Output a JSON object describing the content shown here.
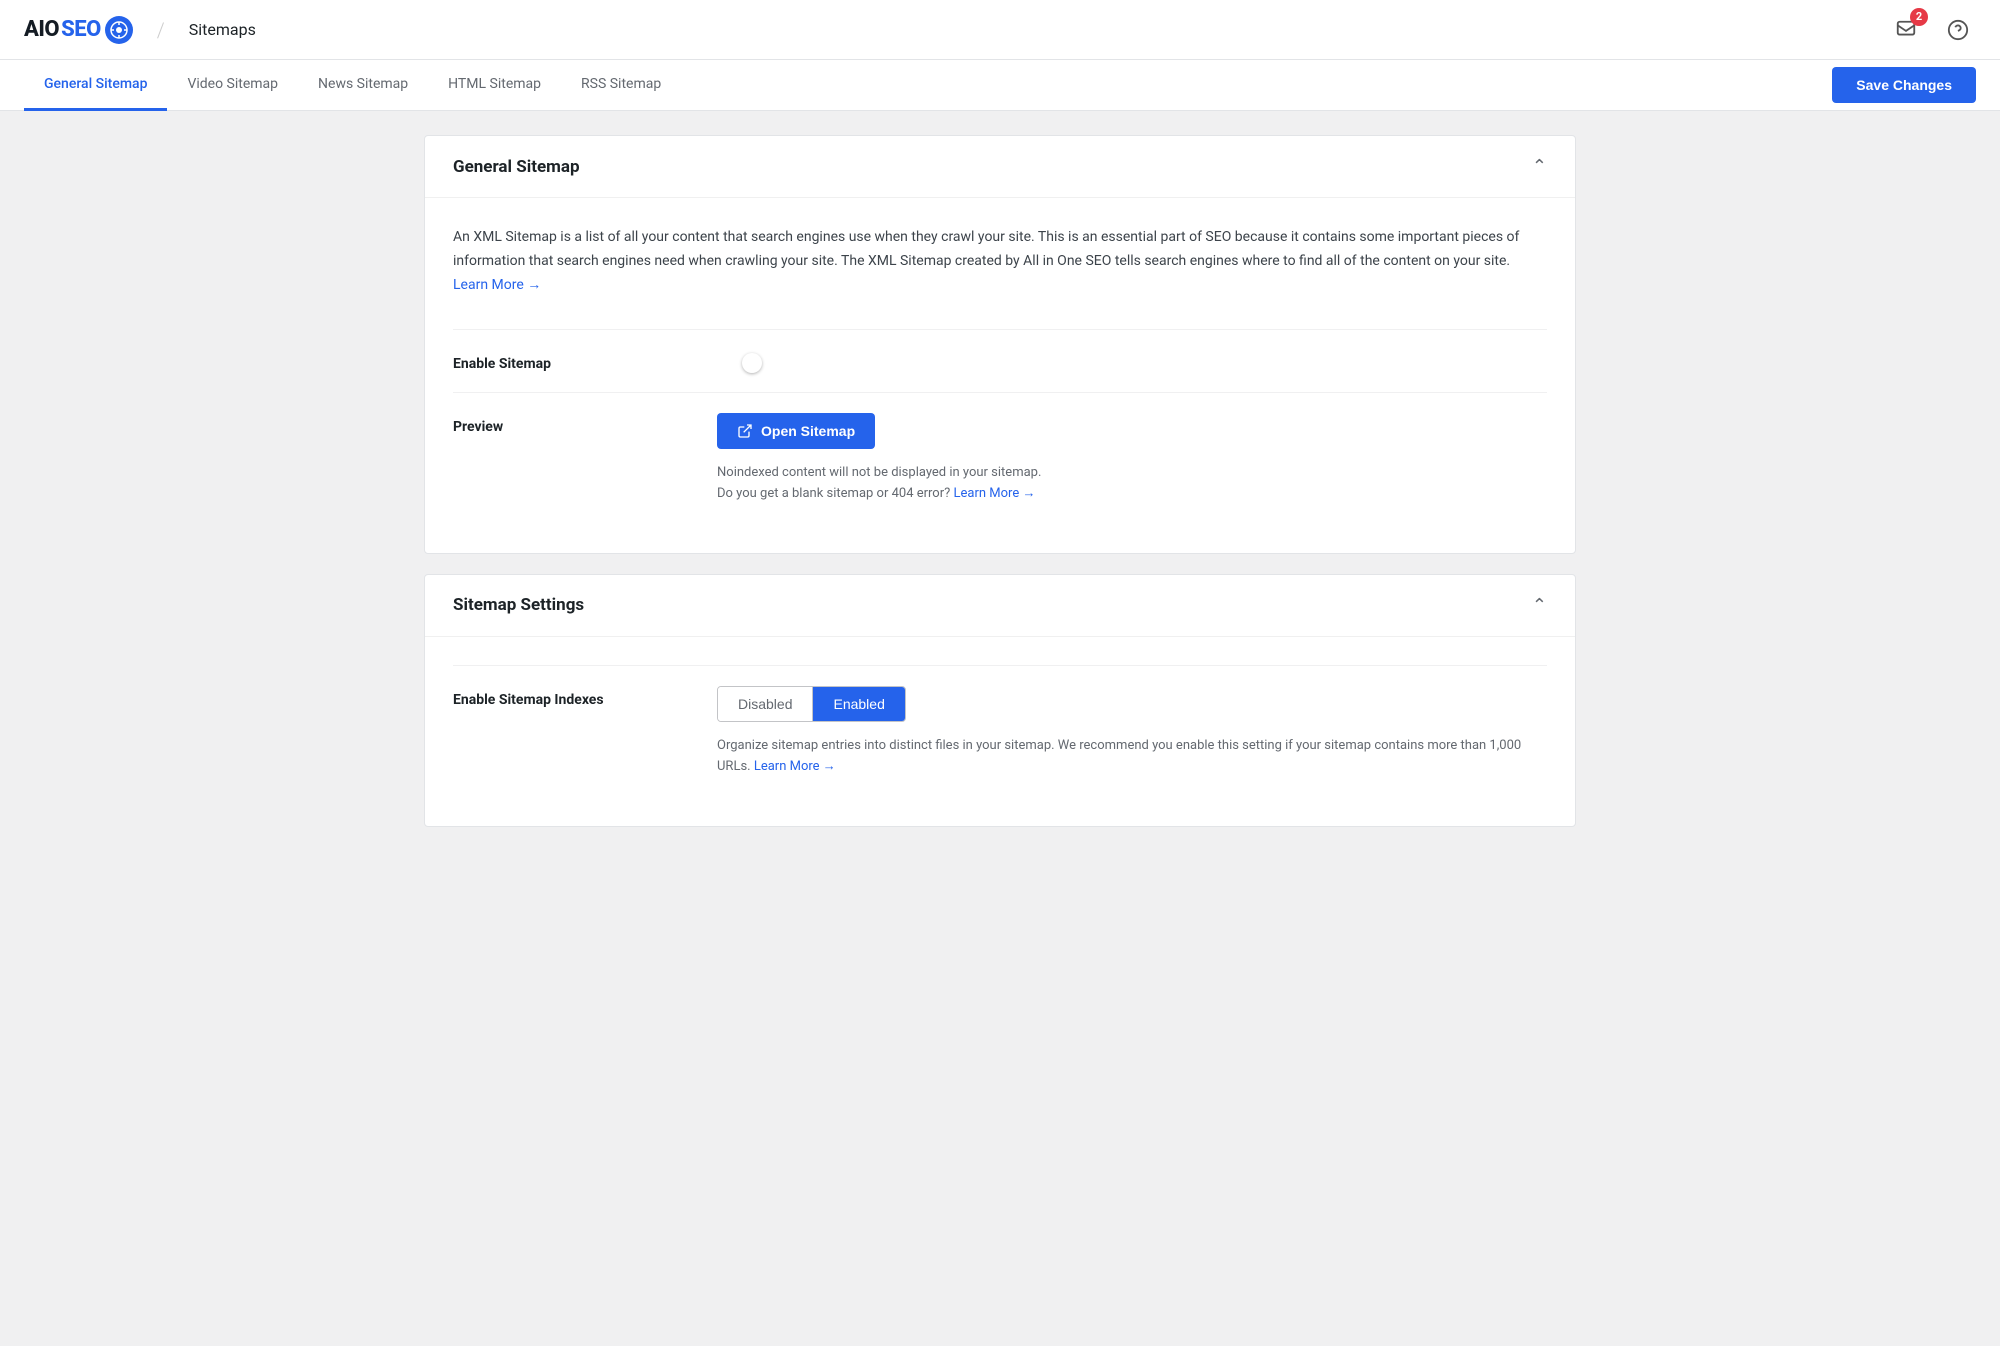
{
  "header": {
    "logo_text_aio": "AIO",
    "logo_text_seo": "SEO",
    "logo_icon_symbol": "⚙",
    "separator": "/",
    "page_title": "Sitemaps",
    "notification_count": "2"
  },
  "tabs": {
    "items": [
      {
        "id": "general-sitemap",
        "label": "General Sitemap",
        "active": true
      },
      {
        "id": "video-sitemap",
        "label": "Video Sitemap",
        "active": false
      },
      {
        "id": "news-sitemap",
        "label": "News Sitemap",
        "active": false
      },
      {
        "id": "html-sitemap",
        "label": "HTML Sitemap",
        "active": false
      },
      {
        "id": "rss-sitemap",
        "label": "RSS Sitemap",
        "active": false
      }
    ],
    "save_label": "Save Changes"
  },
  "general_sitemap_card": {
    "title": "General Sitemap",
    "description": "An XML Sitemap is a list of all your content that search engines use when they crawl your site. This is an essential part of SEO because it contains some important pieces of information that search engines need when crawling your site. The XML Sitemap created by All in One SEO tells search engines where to find all of the content on your site.",
    "learn_more_text": "Learn More →",
    "learn_more_url": "#",
    "enable_sitemap_label": "Enable Sitemap",
    "toggle_enabled": true,
    "preview_label": "Preview",
    "open_sitemap_label": "Open Sitemap",
    "preview_note_line1": "Noindexed content will not be displayed in your sitemap.",
    "preview_note_line2": "Do you get a blank sitemap or 404 error?",
    "preview_learn_more": "Learn More →"
  },
  "sitemap_settings_card": {
    "title": "Sitemap Settings",
    "enable_indexes_label": "Enable Sitemap Indexes",
    "indexes_disabled_label": "Disabled",
    "indexes_enabled_label": "Enabled",
    "indexes_active": "Enabled",
    "indexes_desc": "Organize sitemap entries into distinct files in your sitemap. We recommend you enable this setting if your sitemap contains more than 1,000 URLs.",
    "indexes_learn_more": "Learn More →"
  }
}
